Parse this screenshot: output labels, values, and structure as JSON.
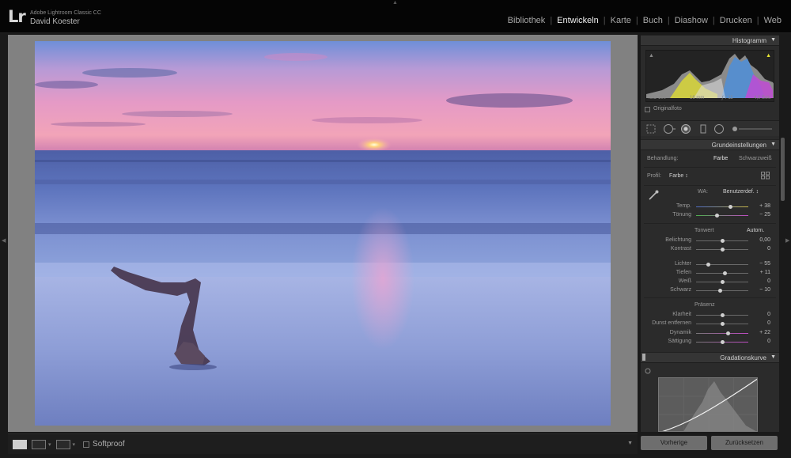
{
  "app": {
    "logo": "Lr",
    "product_name": "Adobe Lightroom Classic CC",
    "user_name": "David Koester"
  },
  "modules": [
    {
      "label": "Bibliothek",
      "active": false
    },
    {
      "label": "Entwickeln",
      "active": true
    },
    {
      "label": "Karte",
      "active": false
    },
    {
      "label": "Buch",
      "active": false
    },
    {
      "label": "Diashow",
      "active": false
    },
    {
      "label": "Drucken",
      "active": false
    },
    {
      "label": "Web",
      "active": false
    }
  ],
  "histogram": {
    "title": "Histogramm",
    "iso": "ISO 100",
    "focal": "16 mm",
    "aperture": "ƒ / 11",
    "shutter": "4,0 Sek.",
    "original_label": "Originalfoto"
  },
  "basic": {
    "title": "Grundeinstellungen",
    "treatment_label": "Behandlung:",
    "treatment_color": "Farbe",
    "treatment_bw": "Schwarzweiß",
    "profile_label": "Profil:",
    "profile_value": "Farbe ↕",
    "wb_label": "WA:",
    "wb_value": "Benutzerdef. ↕",
    "tone_label": "Tonwert",
    "auto_label": "Autom.",
    "presence_label": "Präsenz",
    "sliders": [
      {
        "label": "Temp.",
        "value": "+ 38",
        "pos": 0.62
      },
      {
        "label": "Tönung",
        "value": "− 25",
        "pos": 0.4
      },
      {
        "label": "Belichtung",
        "value": "0,00",
        "pos": 0.5
      },
      {
        "label": "Kontrast",
        "value": "0",
        "pos": 0.5
      },
      {
        "label": "Lichter",
        "value": "− 55",
        "pos": 0.22
      },
      {
        "label": "Tiefen",
        "value": "+ 11",
        "pos": 0.55
      },
      {
        "label": "Weiß",
        "value": "0",
        "pos": 0.5
      },
      {
        "label": "Schwarz",
        "value": "− 10",
        "pos": 0.45
      },
      {
        "label": "Klarheit",
        "value": "0",
        "pos": 0.5
      },
      {
        "label": "Dunst entfernen",
        "value": "0",
        "pos": 0.5
      },
      {
        "label": "Dynamik",
        "value": "+ 22",
        "pos": 0.61
      },
      {
        "label": "Sättigung",
        "value": "0",
        "pos": 0.5
      }
    ]
  },
  "curve": {
    "title": "Gradationskurve"
  },
  "toolbar": {
    "softproof": "Softproof"
  },
  "buttons": {
    "previous": "Vorherige",
    "reset": "Zurücksetzen"
  }
}
